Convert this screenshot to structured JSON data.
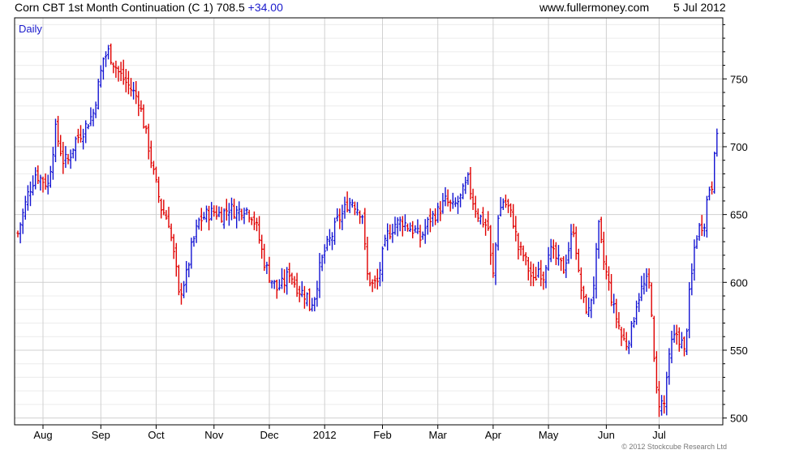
{
  "header": {
    "title": "Corn CBT 1st Month Continuation (C 1) 708.5",
    "change": "+34.00",
    "site": "www.fullermoney.com",
    "date": "5 Jul 2012"
  },
  "chart_data": {
    "type": "ohlc",
    "period_label": "Daily",
    "copyright": "© 2012 Stockcube Research Ltd",
    "x_tick_labels": [
      "Aug",
      "Sep",
      "Oct",
      "Nov",
      "Dec",
      "2012",
      "Feb",
      "Mar",
      "Apr",
      "May",
      "Jun",
      "Jul"
    ],
    "x_tick_bar_index": [
      10,
      33,
      55,
      78,
      100,
      122,
      145,
      167,
      189,
      211,
      234,
      255
    ],
    "y_tick_values": [
      500,
      550,
      600,
      650,
      700,
      750
    ],
    "ylim": [
      495,
      795
    ],
    "grid": true,
    "axis_side": "right",
    "colors": {
      "up": "#1414d2",
      "down": "#e00000",
      "grid": "#d0d0d0",
      "axis": "#000000"
    },
    "close_path": [
      [
        0,
        636
      ],
      [
        4,
        665
      ],
      [
        7,
        680
      ],
      [
        12,
        672
      ],
      [
        15,
        712
      ],
      [
        18,
        690
      ],
      [
        20,
        690
      ],
      [
        23,
        705
      ],
      [
        26,
        712
      ],
      [
        30,
        725
      ],
      [
        34,
        765
      ],
      [
        36,
        770
      ],
      [
        40,
        755
      ],
      [
        44,
        745
      ],
      [
        48,
        735
      ],
      [
        52,
        700
      ],
      [
        54,
        680
      ],
      [
        57,
        655
      ],
      [
        60,
        645
      ],
      [
        63,
        608
      ],
      [
        64,
        590
      ],
      [
        67,
        605
      ],
      [
        69,
        625
      ],
      [
        72,
        645
      ],
      [
        75,
        650
      ],
      [
        78,
        652
      ],
      [
        81,
        650
      ],
      [
        84,
        655
      ],
      [
        87,
        652
      ],
      [
        90,
        655
      ],
      [
        93,
        650
      ],
      [
        95,
        640
      ],
      [
        98,
        615
      ],
      [
        100,
        605
      ],
      [
        103,
        595
      ],
      [
        106,
        600
      ],
      [
        108,
        608
      ],
      [
        110,
        600
      ],
      [
        112,
        594
      ],
      [
        115,
        590
      ],
      [
        116,
        582
      ],
      [
        118,
        590
      ],
      [
        120,
        610
      ],
      [
        122,
        623
      ],
      [
        125,
        635
      ],
      [
        127,
        645
      ],
      [
        129,
        650
      ],
      [
        131,
        658
      ],
      [
        133,
        660
      ],
      [
        135,
        655
      ],
      [
        137,
        650
      ],
      [
        138,
        625
      ],
      [
        139,
        605
      ],
      [
        141,
        598
      ],
      [
        143,
        600
      ],
      [
        145,
        620
      ],
      [
        147,
        635
      ],
      [
        150,
        643
      ],
      [
        153,
        645
      ],
      [
        156,
        640
      ],
      [
        158,
        638
      ],
      [
        160,
        632
      ],
      [
        162,
        640
      ],
      [
        164,
        647
      ],
      [
        167,
        652
      ],
      [
        170,
        660
      ],
      [
        173,
        655
      ],
      [
        176,
        662
      ],
      [
        179,
        675
      ],
      [
        181,
        660
      ],
      [
        183,
        650
      ],
      [
        185,
        645
      ],
      [
        187,
        640
      ],
      [
        188,
        618
      ],
      [
        189,
        605
      ],
      [
        191,
        650
      ],
      [
        193,
        660
      ],
      [
        195,
        655
      ],
      [
        197,
        645
      ],
      [
        199,
        625
      ],
      [
        201,
        620
      ],
      [
        203,
        610
      ],
      [
        205,
        600
      ],
      [
        207,
        610
      ],
      [
        209,
        605
      ],
      [
        211,
        625
      ],
      [
        213,
        620
      ],
      [
        215,
        615
      ],
      [
        217,
        610
      ],
      [
        219,
        625
      ],
      [
        221,
        640
      ],
      [
        222,
        625
      ],
      [
        223,
        605
      ],
      [
        225,
        585
      ],
      [
        227,
        578
      ],
      [
        229,
        600
      ],
      [
        230,
        620
      ],
      [
        231,
        640
      ],
      [
        233,
        615
      ],
      [
        235,
        598
      ],
      [
        237,
        580
      ],
      [
        239,
        568
      ],
      [
        240,
        560
      ],
      [
        242,
        555
      ],
      [
        244,
        565
      ],
      [
        246,
        585
      ],
      [
        248,
        595
      ],
      [
        250,
        600
      ],
      [
        251,
        598
      ],
      [
        252,
        580
      ],
      [
        253,
        540
      ],
      [
        254,
        520
      ],
      [
        255,
        512
      ],
      [
        257,
        510
      ],
      [
        258,
        530
      ],
      [
        260,
        555
      ],
      [
        262,
        562
      ],
      [
        264,
        555
      ],
      [
        265,
        548
      ],
      [
        266,
        568
      ],
      [
        267,
        590
      ],
      [
        268,
        605
      ],
      [
        269,
        625
      ],
      [
        270,
        635
      ],
      [
        271,
        640
      ],
      [
        273,
        645
      ],
      [
        274,
        660
      ],
      [
        275,
        670
      ],
      [
        276,
        672
      ],
      [
        277,
        700
      ],
      [
        278,
        705
      ]
    ]
  }
}
